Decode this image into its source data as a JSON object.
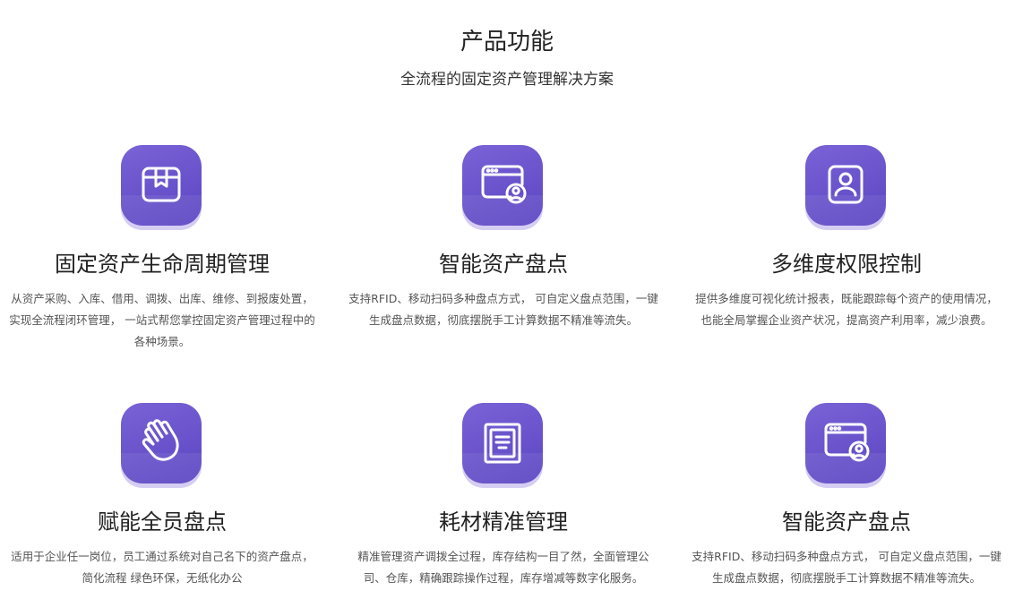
{
  "header": {
    "title": "产品功能",
    "subtitle": "全流程的固定资产管理解决方案"
  },
  "colors": {
    "icon_gradient_start": "#7a62d6",
    "icon_gradient_end": "#5b45c2",
    "icon_shadow": "#d6cdf3"
  },
  "features": [
    {
      "icon": "box-bookmark-icon",
      "title": "固定资产生命周期管理",
      "desc_lines": [
        "从资产采购、入库、借用、调拨、出库、维修、到报废处置，",
        "实现全流程闭环管理，  一站式帮您掌控固定资产管理过程中的",
        "各种场景。"
      ]
    },
    {
      "icon": "browser-user-icon",
      "title": "智能资产盘点",
      "desc_lines": [
        "支持RFID、移动扫码多种盘点方式，  可自定义盘点范围，一键",
        "生成盘点数据，彻底摆脱手工计算数据不精准等流失。"
      ]
    },
    {
      "icon": "user-card-icon",
      "title": "多维度权限控制",
      "desc_lines": [
        "提供多维度可视化统计报表，既能跟踪每个资产的使用情况，",
        "也能全局掌握企业资产状况，提高资产利用率，减少浪费。"
      ]
    },
    {
      "icon": "hand-wave-icon",
      "title": "赋能全员盘点",
      "desc_lines": [
        "适用于企业任一岗位，员工通过系统对自己名下的资产盘点，",
        "简化流程 绿色环保，无纸化办公"
      ]
    },
    {
      "icon": "document-frame-icon",
      "title": "耗材精准管理",
      "desc_lines": [
        "精准管理资产调拨全过程，库存结构一目了然，全面管理公",
        "司、仓库，精确跟踪操作过程，库存增减等数字化服务。"
      ]
    },
    {
      "icon": "browser-user-icon",
      "title": "智能资产盘点",
      "desc_lines": [
        "支持RFID、移动扫码多种盘点方式，  可自定义盘点范围，一键",
        "生成盘点数据，彻底摆脱手工计算数据不精准等流失。"
      ]
    }
  ]
}
